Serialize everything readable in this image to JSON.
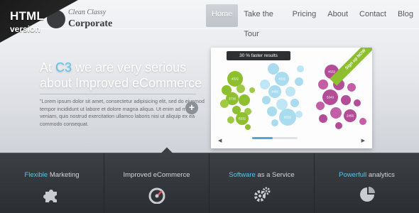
{
  "ribbon": {
    "line1": "HTML",
    "line2": "version"
  },
  "logo": {
    "mark": "3",
    "tagline": "Clean Classy",
    "name": "Corporate"
  },
  "nav": {
    "items": [
      {
        "label": "Home",
        "active": true
      },
      {
        "label": "Take the Tour",
        "active": false
      },
      {
        "label": "Pricing",
        "active": false
      },
      {
        "label": "About",
        "active": false
      },
      {
        "label": "Contact",
        "active": false
      },
      {
        "label": "Blog",
        "active": false
      }
    ]
  },
  "hero": {
    "headline_pre": "At",
    "headline_accent": "C3",
    "headline_post": "we are very serious about Improved eCommerce",
    "body": "\"Lorem ipsum dolor sit amet, consectetur adipisicing elit, sed do eiusmod tempor incididunt ut labore et dolore magna aliqua. Ut enim ad minim veniam, quis nostrud exercitation ullamco laboris nisi ut aliquip ex ea commodo consequat.",
    "plus": "+"
  },
  "panel": {
    "badge": "30 % faster results",
    "corner": "Sign up NOW",
    "left_arrow": "◀",
    "right_arrow": "▶",
    "progress": 0.45,
    "bubble_labels": [
      "4532",
      "3736",
      "6532",
      "4532",
      "3456",
      "4532",
      "5343",
      "6532",
      "2456"
    ]
  },
  "features": [
    {
      "hl": "Flexible",
      "rest": " Marketing",
      "icon": "puzzle-icon"
    },
    {
      "hl": "",
      "rest": "Improved eCommerce",
      "icon": "speedometer-icon"
    },
    {
      "hl": "Software",
      "rest": " as a Service",
      "icon": "gears-icon"
    },
    {
      "hl": "Powerfull",
      "rest": " analytics",
      "icon": "pie-chart-icon"
    }
  ],
  "colors": {
    "accent": "#5ec3e8",
    "green": "#8dbf2f",
    "lightblue": "#a9dcef",
    "purple": "#b44d97"
  }
}
